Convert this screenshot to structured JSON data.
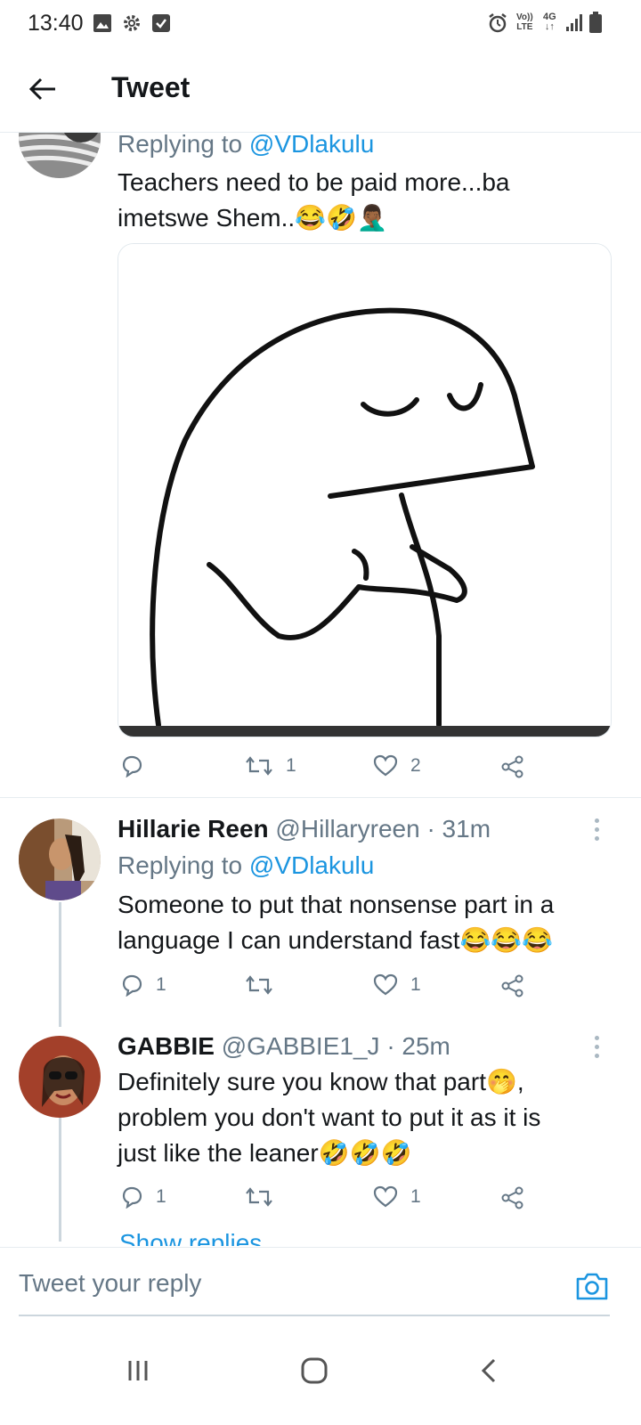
{
  "status_bar": {
    "time": "13:40",
    "icons": [
      "image-icon",
      "gear-icon",
      "check-box-icon",
      "alarm-icon",
      "volte-icon",
      "4g-icon",
      "signal-icon",
      "battery-icon"
    ],
    "volte_label_top": "Vo))",
    "volte_label_bottom": "LTE",
    "network_label": "4G"
  },
  "header": {
    "title": "Tweet",
    "back_icon": "arrow-left-icon"
  },
  "tweet_top": {
    "replying_prefix": "Replying to",
    "replying_handle": "@VDlakulu",
    "text_line1": "Teachers need to be paid more...ba",
    "text_line2": "imetswe Shem..",
    "emojis": [
      "😂",
      "🤣",
      "🤦🏾‍♂️"
    ],
    "actions": {
      "reply_count": "",
      "retweet_count": "1",
      "like_count": "2"
    }
  },
  "replies": [
    {
      "name": "Hillarie Reen",
      "handle": "@Hillaryreen",
      "time": "· 31m",
      "replying_prefix": "Replying to",
      "replying_handle": "@VDlakulu",
      "text_line1": "Someone to put that nonsense part in a",
      "text_line2": "language I can understand fast",
      "emojis": [
        "😂",
        "😂",
        "😂"
      ],
      "actions": {
        "reply_count": "1",
        "retweet_count": "",
        "like_count": "1"
      }
    },
    {
      "name": "GABBIE",
      "handle": "@GABBIE1_J",
      "time": "· 25m",
      "text_line1": "Definitely sure you know that part",
      "text_line1_emoji": "🤭",
      "text_line1_tail": ",",
      "text_line2": "problem  you  don't want to put it as it is",
      "text_line3": "just like the leaner",
      "emojis": [
        "🤣",
        "🤣",
        "🤣"
      ],
      "actions": {
        "reply_count": "1",
        "retweet_count": "",
        "like_count": "1"
      },
      "show_replies": "Show replies"
    }
  ],
  "composer": {
    "placeholder": "Tweet your reply",
    "camera_icon": "camera-icon"
  },
  "nav_bar": {
    "icons": [
      "recent-apps-icon",
      "home-icon",
      "back-icon"
    ]
  },
  "colors": {
    "accent": "#1b95e0",
    "text": "#14171a",
    "muted": "#657786",
    "border": "#e6ecf0"
  }
}
